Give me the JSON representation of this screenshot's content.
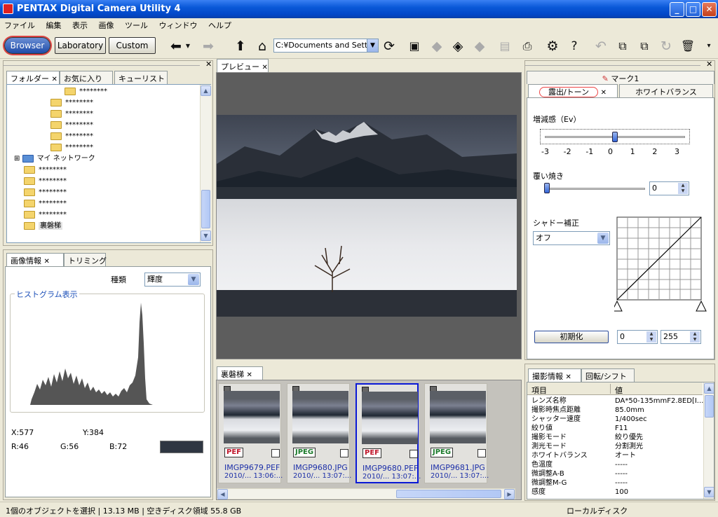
{
  "window": {
    "title": "PENTAX Digital Camera Utility 4",
    "min": "_",
    "max": "□",
    "close": "✕"
  },
  "menu": [
    "ファイル",
    "編集",
    "表示",
    "画像",
    "ツール",
    "ウィンドウ",
    "ヘルプ"
  ],
  "toolbar": {
    "modes": [
      "Browser",
      "Laboratory",
      "Custom"
    ],
    "path": "C:¥Documents and Settir",
    "icons": [
      "back-arrow-icon",
      "dropdown-icon",
      "forward-arrow-icon",
      "up-arrow-icon",
      "home-icon",
      "refresh-icon",
      "save-icon",
      "diamond-icon",
      "export-icon",
      "diamond-grey-icon",
      "monitor-icon",
      "printer-icon",
      "settings-gear-icon",
      "help-icon",
      "undo-icon",
      "copy-icon",
      "paste-icon",
      "rotate-icon",
      "trash-icon",
      "overflow-icon"
    ]
  },
  "folder_panel": {
    "tabs": [
      "フォルダー",
      "お気に入り",
      "キューリスト"
    ],
    "tree": [
      {
        "label": "********",
        "indent": 3
      },
      {
        "label": "********",
        "indent": 2
      },
      {
        "label": "********",
        "indent": 2
      },
      {
        "label": "********",
        "indent": 2
      },
      {
        "label": "********",
        "indent": 2
      },
      {
        "label": "********",
        "indent": 2
      },
      {
        "label": "マイ ネットワーク",
        "indent": 0
      },
      {
        "label": "********",
        "indent": 1
      },
      {
        "label": "********",
        "indent": 1
      },
      {
        "label": "********",
        "indent": 1
      },
      {
        "label": "********",
        "indent": 1
      },
      {
        "label": "********",
        "indent": 1
      },
      {
        "label": "裏磐梯",
        "indent": 1
      }
    ]
  },
  "info_panel": {
    "tabs": [
      "画像情報",
      "トリミング"
    ],
    "type_label": "種類",
    "type_value": "輝度",
    "histogram_title": "ヒストグラム表示",
    "x": "X:577",
    "y": "Y:384",
    "r": "R:46",
    "g": "G:56",
    "b": "B:72",
    "swatch_color": "#2f3642"
  },
  "preview": {
    "tab": "プレビュー"
  },
  "thumbs_panel": {
    "tab": "裏磐梯",
    "items": [
      {
        "badge": "PEF",
        "name": "IMGP9679.PEF",
        "date": "2010/...   13:06:...",
        "selected": false
      },
      {
        "badge": "JPEG",
        "name": "IMGP9680.JPG",
        "date": "2010/...   13:07:...",
        "selected": false
      },
      {
        "badge": "PEF",
        "name": "IMGP9680.PEF",
        "date": "2010/...   13:07:...",
        "selected": true
      },
      {
        "badge": "JPEG",
        "name": "IMGP9681.JPG",
        "date": "2010/...   13:07:...",
        "selected": false
      }
    ]
  },
  "adjust_panel": {
    "top_tab": "マーク1",
    "tabs": [
      "露出/トーン",
      "ホワイトバランス"
    ],
    "ev_label": "増減感（Ev）",
    "ev_ticks": [
      "-3",
      "-2",
      "-1",
      "0",
      "1",
      "2",
      "3"
    ],
    "ev_value": 0,
    "burn_label": "覆い焼き",
    "burn_value": "0",
    "shadow_label": "シャドー補正",
    "shadow_value": "オフ",
    "reset_label": "初期化",
    "low_value": "0",
    "high_value": "255"
  },
  "shooting_panel": {
    "tabs": [
      "撮影情報",
      "回転/シフト"
    ],
    "col_item": "項目",
    "col_value": "値",
    "rows": [
      [
        "レンズ名称",
        "DA*50-135mmF2.8ED[I..."
      ],
      [
        "撮影時焦点距離",
        "85.0mm"
      ],
      [
        "シャッター速度",
        "1/400sec"
      ],
      [
        "絞り値",
        "F11"
      ],
      [
        "撮影モード",
        "絞り優先"
      ],
      [
        "測光モード",
        "分割測光"
      ],
      [
        "ホワイトバランス",
        "オート"
      ],
      [
        "色温度",
        "-----"
      ],
      [
        "微調整A-B",
        "-----"
      ],
      [
        "微調整M-G",
        "-----"
      ],
      [
        "感度",
        "100"
      ]
    ]
  },
  "status": {
    "left": "1個のオブジェクトを選択 | 13.13 MB | 空きディスク領域 55.8 GB",
    "right": "ローカルディスク"
  }
}
